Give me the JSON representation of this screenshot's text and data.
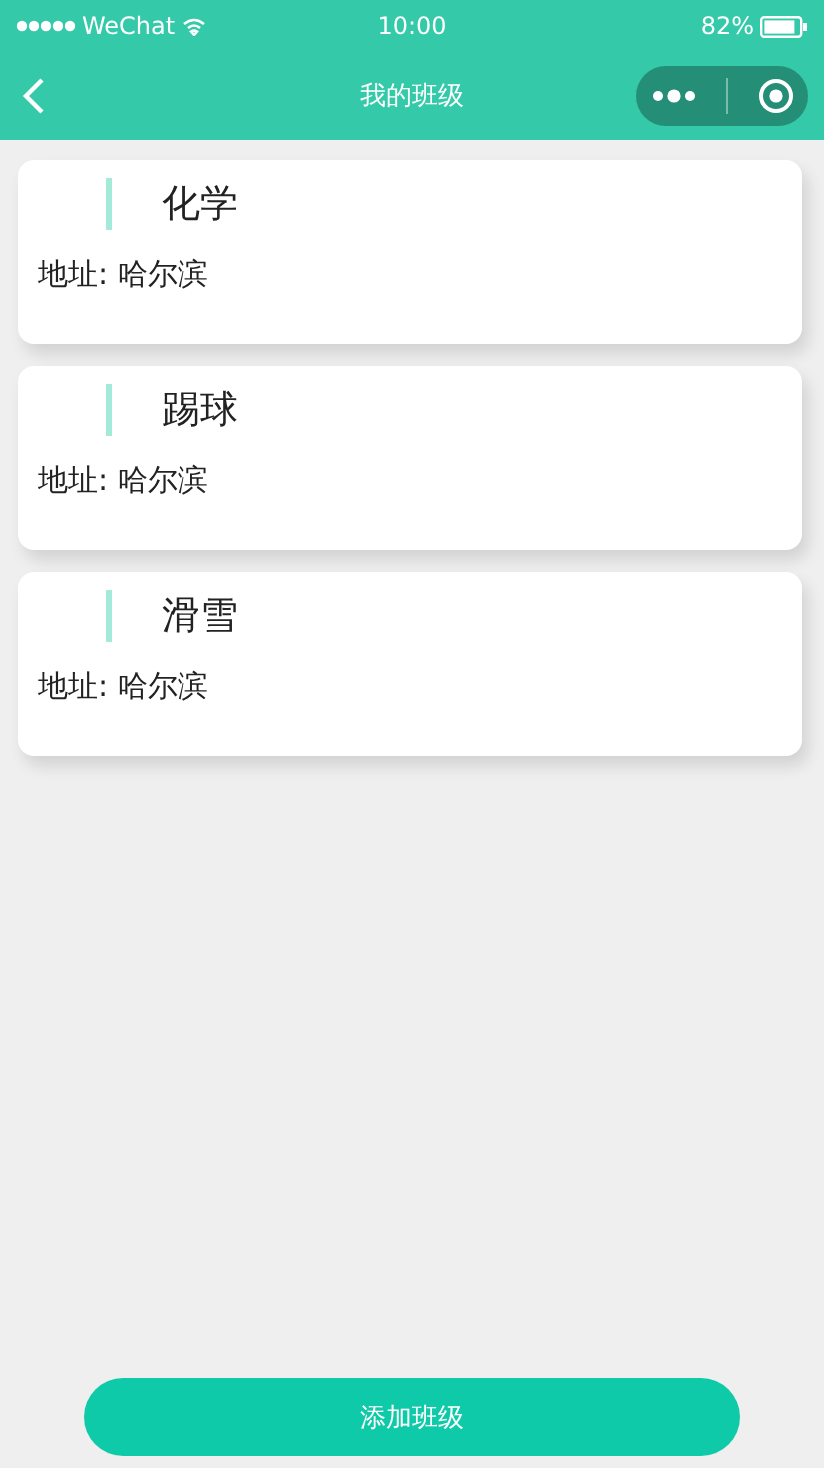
{
  "status_bar": {
    "carrier": "WeChat",
    "time": "10:00",
    "battery": "82%"
  },
  "nav": {
    "title": "我的班级"
  },
  "classes": [
    {
      "name": "化学",
      "address_label": "地址:",
      "address": "哈尔滨"
    },
    {
      "name": "踢球",
      "address_label": "地址:",
      "address": "哈尔滨"
    },
    {
      "name": "滑雪",
      "address_label": "地址:",
      "address": "哈尔滨"
    }
  ],
  "add_button": "添加班级"
}
